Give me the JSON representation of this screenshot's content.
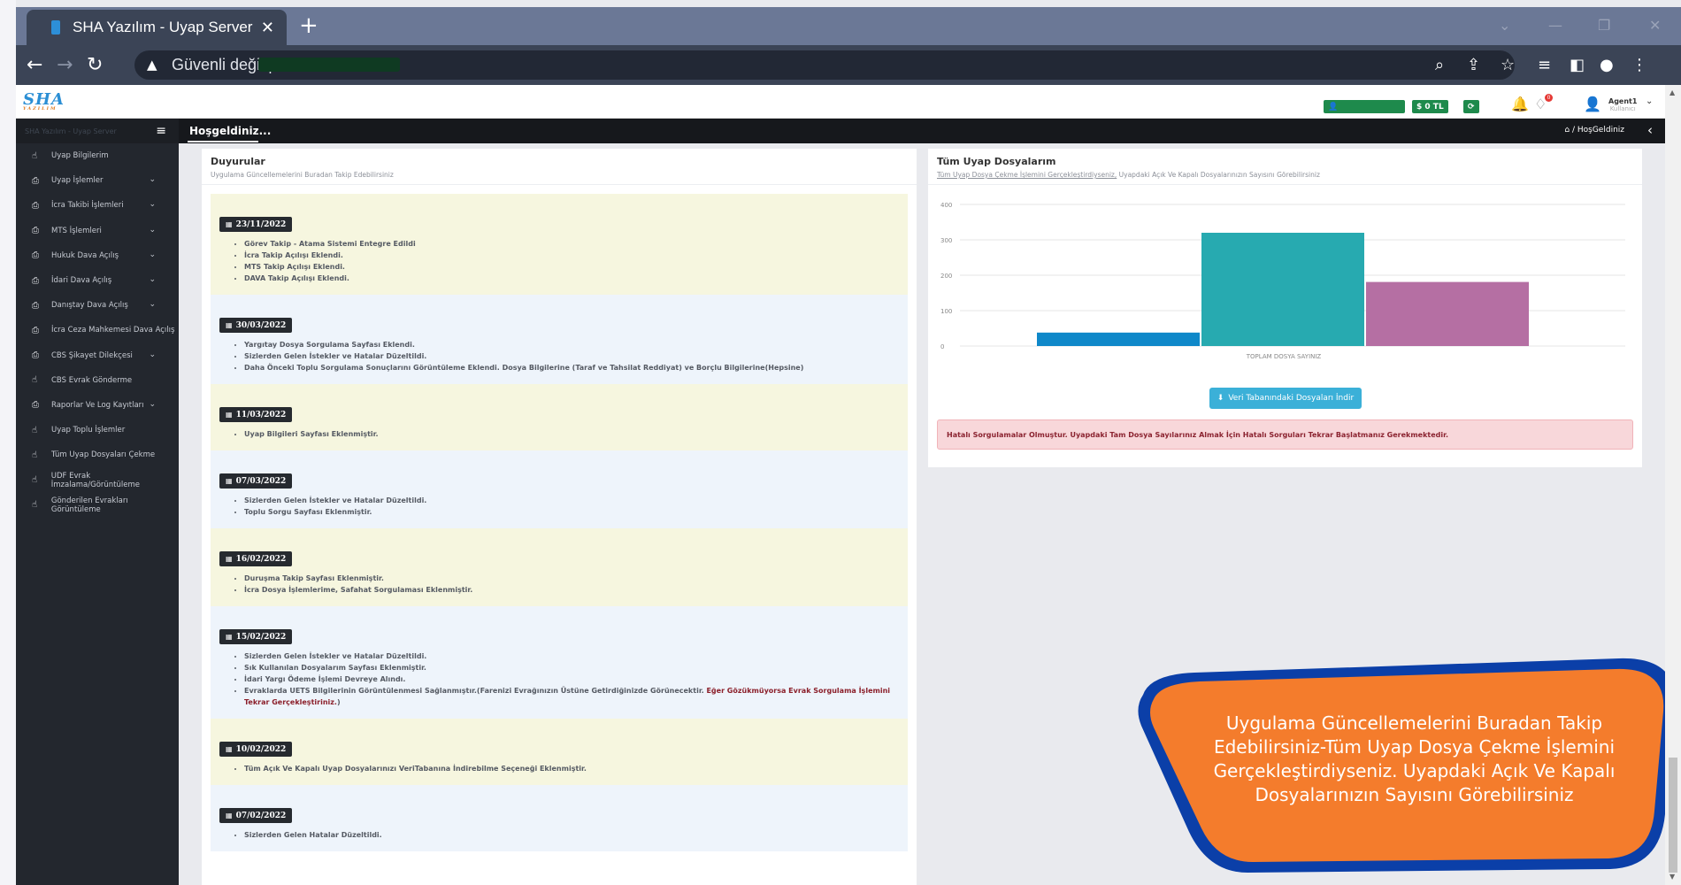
{
  "browser": {
    "tab_title": "SHA Yazılım - Uyap Server",
    "security_label": "Güvenli değil |"
  },
  "header": {
    "logo": "SHA",
    "logo_sub": "YAZILIM",
    "balance": "0 TL",
    "notif_count": "0",
    "user_name": "Agent1",
    "user_role": "Kullanıcı"
  },
  "sidebar": {
    "brand": "SHA Yazılım - Uyap Server",
    "items": [
      {
        "label": "Uyap Bilgilerim",
        "icon": "hand-pointer-icon",
        "has_sub": false
      },
      {
        "label": "Uyap İşlemler",
        "icon": "printer-icon",
        "has_sub": true
      },
      {
        "label": "İcra Takibi İşlemleri",
        "icon": "printer-icon",
        "has_sub": true
      },
      {
        "label": "MTS İşlemleri",
        "icon": "printer-icon",
        "has_sub": true
      },
      {
        "label": "Hukuk Dava Açılış",
        "icon": "printer-icon",
        "has_sub": true
      },
      {
        "label": "İdari Dava Açılış",
        "icon": "printer-icon",
        "has_sub": true
      },
      {
        "label": "Danıştay Dava Açılış",
        "icon": "printer-icon",
        "has_sub": true
      },
      {
        "label": "İcra Ceza Mahkemesi Dava Açılış",
        "icon": "printer-icon",
        "has_sub": false
      },
      {
        "label": "CBS Şikayet Dilekçesi",
        "icon": "printer-icon",
        "has_sub": true
      },
      {
        "label": "CBS Evrak Gönderme",
        "icon": "hand-pointer-icon",
        "has_sub": false
      },
      {
        "label": "Raporlar Ve Log Kayıtları",
        "icon": "printer-icon",
        "has_sub": true
      },
      {
        "label": "Uyap Toplu İşlemler",
        "icon": "hand-pointer-icon",
        "has_sub": false
      },
      {
        "label": "Tüm Uyap Dosyaları Çekme",
        "icon": "hand-pointer-icon",
        "has_sub": false
      },
      {
        "label": "UDF Evrak İmzalama/Görüntüleme",
        "icon": "hand-pointer-icon",
        "has_sub": false
      },
      {
        "label": "Gönderilen Evrakları Görüntüleme",
        "icon": "hand-pointer-icon",
        "has_sub": false
      }
    ]
  },
  "content_bar": {
    "title": "Hoşgeldiniz...",
    "breadcrumb_sep": "/",
    "breadcrumb": "HoşGeldiniz"
  },
  "announcements": {
    "title": "Duyurular",
    "subtitle": "Uygulama Güncellemelerini Buradan Takip Edebilirsiniz",
    "entries": [
      {
        "date": "23/11/2022",
        "items": [
          "Görev Takip - Atama Sistemi Entegre Edildi",
          "İcra Takip Açılışı Eklendi.",
          "MTS Takip Açılışı Eklendi.",
          "DAVA Takip Açılışı Eklendi."
        ]
      },
      {
        "date": "30/03/2022",
        "items": [
          "Yargıtay Dosya Sorgulama Sayfası Eklendi.",
          "Sizlerden Gelen İstekler ve Hatalar Düzeltildi.",
          "Daha Önceki Toplu Sorgulama Sonuçlarını Görüntüleme Eklendi. Dosya Bilgilerine (Taraf ve Tahsilat Reddiyat) ve Borçlu Bilgilerine(Hepsine)"
        ]
      },
      {
        "date": "11/03/2022",
        "items": [
          "Uyap Bilgileri Sayfası Eklenmiştir."
        ]
      },
      {
        "date": "07/03/2022",
        "items": [
          "Sizlerden Gelen İstekler ve Hatalar Düzeltildi.",
          "Toplu Sorgu Sayfası Eklenmiştir."
        ]
      },
      {
        "date": "16/02/2022",
        "items": [
          "Duruşma Takip Sayfası Eklenmiştir.",
          "İcra Dosya İşlemlerime, Safahat Sorgulaması Eklenmiştir."
        ]
      },
      {
        "date": "15/02/2022",
        "items": [
          "Sizlerden Gelen İstekler ve Hatalar Düzeltildi.",
          "Sık Kullanılan Dosyalarım Sayfası Eklenmiştir.",
          "İdari Yargı Ödeme İşlemi Devreye Alındı."
        ],
        "extra_text": "Evraklarda UETS Bilgilerinin Görüntülenmesi Sağlanmıştır.(Farenizi Evrağınızın Üstüne Getirdiğinizde Görünecektir. ",
        "extra_red": "Eğer Gözükmüyorsa Evrak Sorgulama İşlemini Tekrar Gerçekleştiriniz.",
        "extra_end": ")"
      },
      {
        "date": "10/02/2022",
        "items": [
          "Tüm Açık Ve Kapalı Uyap Dosyalarınızı VeriTabanına İndirebilme Seçeneği Eklenmiştir."
        ]
      },
      {
        "date": "07/02/2022",
        "items": [
          "Sizlerden Gelen Hatalar Düzeltildi."
        ]
      }
    ]
  },
  "files_card": {
    "title": "Tüm Uyap Dosyalarım",
    "subtitle_link": "Tüm Uyap Dosya Çekme İşlemini Gerçekleştirdiyseniz,",
    "subtitle_rest": " Uyapdaki Açık Ve Kapalı Dosyalarınızın Sayısını Görebilirsiniz",
    "download_button": "Veri Tabanındaki Dosyaları İndir",
    "alert": "Hatalı Sorgulamalar Olmuştur. Uyapdaki Tam Dosya Sayılarınız Almak İçin Hatalı Sorguları Tekrar Başlatmanız Gerekmektedir."
  },
  "chart_data": {
    "type": "bar",
    "categories": [
      "TOPLAM DOSYA SAYINIZ"
    ],
    "series": [
      {
        "values": [
          38
        ],
        "color": "#0f88c9"
      },
      {
        "values": [
          320
        ],
        "color": "#27aab0"
      },
      {
        "values": [
          181
        ],
        "color": "#b56fa3"
      }
    ],
    "xlabel": "TOPLAM DOSYA SAYINIZ",
    "ylim": [
      0,
      400
    ],
    "yticks": [
      0,
      100,
      200,
      300,
      400
    ],
    "grid": true
  },
  "callout": {
    "text": "Uygulama Güncellemelerini Buradan Takip Edebilirsiniz-Tüm Uyap Dosya Çekme İşlemini Gerçekleştirdiyseniz. Uyapdaki Açık Ve Kapalı Dosyalarınızın Sayısını Görebilirsiniz",
    "fill": "#f47c2c",
    "border": "#0b3fa8"
  }
}
